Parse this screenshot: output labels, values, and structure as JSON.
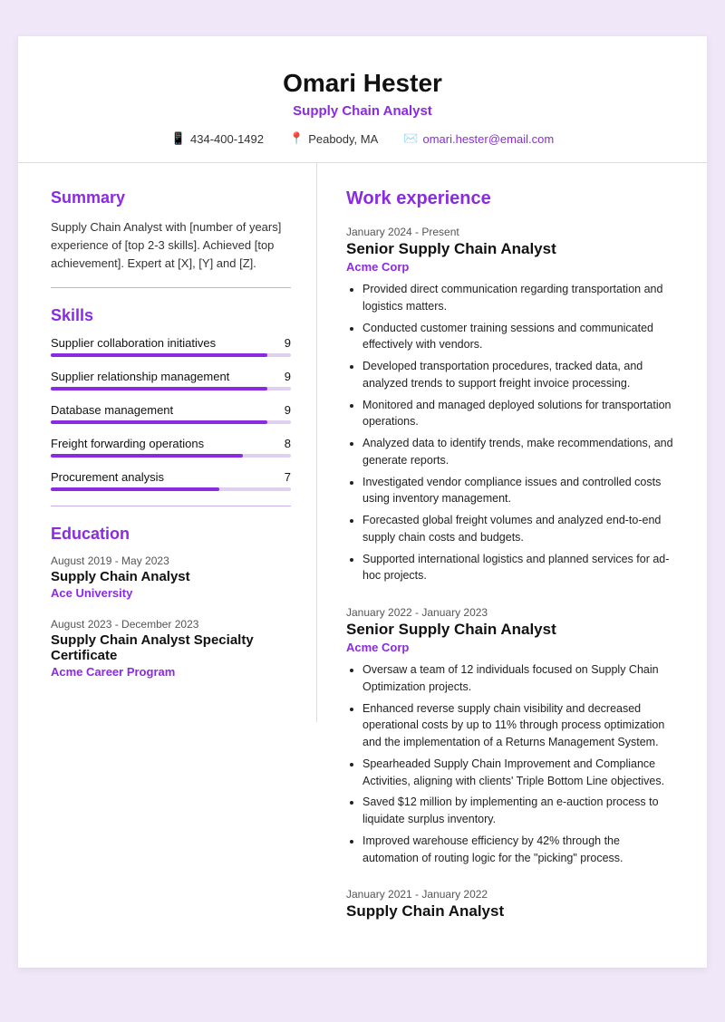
{
  "header": {
    "name": "Omari Hester",
    "title": "Supply Chain Analyst",
    "phone": "434-400-1492",
    "location": "Peabody, MA",
    "email": "omari.hester@email.com"
  },
  "summary": {
    "section_title": "Summary",
    "text": "Supply Chain Analyst with [number of years] experience of [top 2-3 skills]. Achieved [top achievement]. Expert at [X], [Y] and [Z]."
  },
  "skills": {
    "section_title": "Skills",
    "items": [
      {
        "name": "Supplier collaboration initiatives",
        "score": 9,
        "pct": 90
      },
      {
        "name": "Supplier relationship management",
        "score": 9,
        "pct": 90
      },
      {
        "name": "Database management",
        "score": 9,
        "pct": 90
      },
      {
        "name": "Freight forwarding operations",
        "score": 8,
        "pct": 80
      },
      {
        "name": "Procurement analysis",
        "score": 7,
        "pct": 70
      }
    ]
  },
  "education": {
    "section_title": "Education",
    "items": [
      {
        "dates": "August 2019 - May 2023",
        "degree": "Supply Chain Analyst",
        "institution": "Ace University"
      },
      {
        "dates": "August 2023 - December 2023",
        "degree": "Supply Chain Analyst Specialty Certificate",
        "institution": "Acme Career Program"
      }
    ]
  },
  "work_experience": {
    "section_title": "Work experience",
    "items": [
      {
        "dates": "January 2024 - Present",
        "title": "Senior Supply Chain Analyst",
        "company": "Acme Corp",
        "bullets": [
          "Provided direct communication regarding transportation and logistics matters.",
          "Conducted customer training sessions and communicated effectively with vendors.",
          "Developed transportation procedures, tracked data, and analyzed trends to support freight invoice processing.",
          "Monitored and managed deployed solutions for transportation operations.",
          "Analyzed data to identify trends, make recommendations, and generate reports.",
          "Investigated vendor compliance issues and controlled costs using inventory management.",
          "Forecasted global freight volumes and analyzed end-to-end supply chain costs and budgets.",
          "Supported international logistics and planned services for ad-hoc projects."
        ]
      },
      {
        "dates": "January 2022 - January 2023",
        "title": "Senior Supply Chain Analyst",
        "company": "Acme Corp",
        "bullets": [
          "Oversaw a team of 12 individuals focused on Supply Chain Optimization projects.",
          "Enhanced reverse supply chain visibility and decreased operational costs by up to 11% through process optimization and the implementation of a Returns Management System.",
          "Spearheaded Supply Chain Improvement and Compliance Activities, aligning with clients' Triple Bottom Line objectives.",
          "Saved $12 million by implementing an e-auction process to liquidate surplus inventory.",
          "Improved warehouse efficiency by 42% through the automation of routing logic for the \"picking\" process."
        ]
      },
      {
        "dates": "January 2021 - January 2022",
        "title": "Supply Chain Analyst",
        "company": "",
        "bullets": []
      }
    ]
  }
}
